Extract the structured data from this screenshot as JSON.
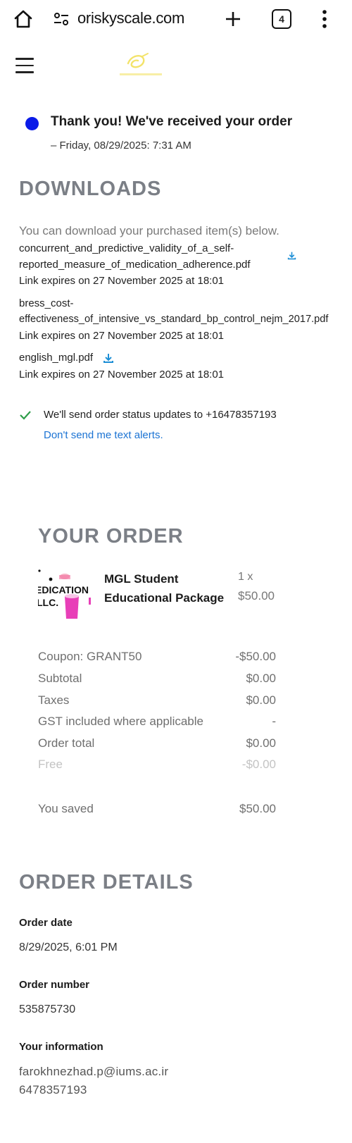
{
  "browser": {
    "url": "oriskyscale.com",
    "tab_count": "4"
  },
  "confirmation": {
    "title": "Thank you! We've received your order",
    "date": "– Friday, 08/29/2025: 7:31 AM"
  },
  "downloads": {
    "heading": "DOWNLOADS",
    "intro": "You can download your purchased item(s) below.",
    "items": [
      {
        "name_line1": "concurrent_and_predictive_validity_of_a_self-",
        "name_line2": "reported_measure_of_medication_adherence.pdf",
        "expires": "Link expires on 27 November 2025 at 18:01"
      },
      {
        "name_line1": "bress_cost-",
        "name_line2": "effectiveness_of_intensive_vs_standard_bp_control_nejm_2017.pdf",
        "expires": "Link expires on 27 November 2025 at 18:01"
      },
      {
        "name_line1": "english_mgl.pdf",
        "expires": "Link expires on 27 November 2025 at 18:01"
      }
    ]
  },
  "sms": {
    "text": "We'll send order status updates to +16478357193",
    "optout_link": "Don't send me text alerts."
  },
  "order": {
    "heading": "YOUR ORDER",
    "product": {
      "image_text_1": "EDICATION",
      "image_text_2": "LLC.",
      "name_line1": "MGL Student",
      "name_line2": "Educational Package",
      "qty": "1 x",
      "price": "$50.00"
    },
    "summary": [
      {
        "label": "Coupon: GRANT50",
        "value": "-$50.00"
      },
      {
        "label": "Subtotal",
        "value": "$0.00"
      },
      {
        "label": "Taxes",
        "value": "$0.00"
      },
      {
        "label": "GST included where applicable",
        "value": "-"
      },
      {
        "label": "Order total",
        "value": "$0.00"
      },
      {
        "label": "Free",
        "value": "-$0.00"
      }
    ],
    "saved_label": "You saved",
    "saved_value": "$50.00"
  },
  "details": {
    "heading": "ORDER DETAILS",
    "order_date_label": "Order date",
    "order_date": "8/29/2025, 6:01 PM",
    "order_number_label": "Order number",
    "order_number": "535875730",
    "info_label": "Your information",
    "email": "farokhnezhad.p@iums.ac.ir",
    "phone": "6478357193"
  },
  "colors": {
    "accent_blue": "#0a1be8",
    "link_blue": "#1b73d3",
    "heading_gray": "#7b7f86",
    "check_green": "#2e9e4a",
    "download_icon": "#1e8fd6",
    "logo_yellow": "#f3e36a"
  }
}
